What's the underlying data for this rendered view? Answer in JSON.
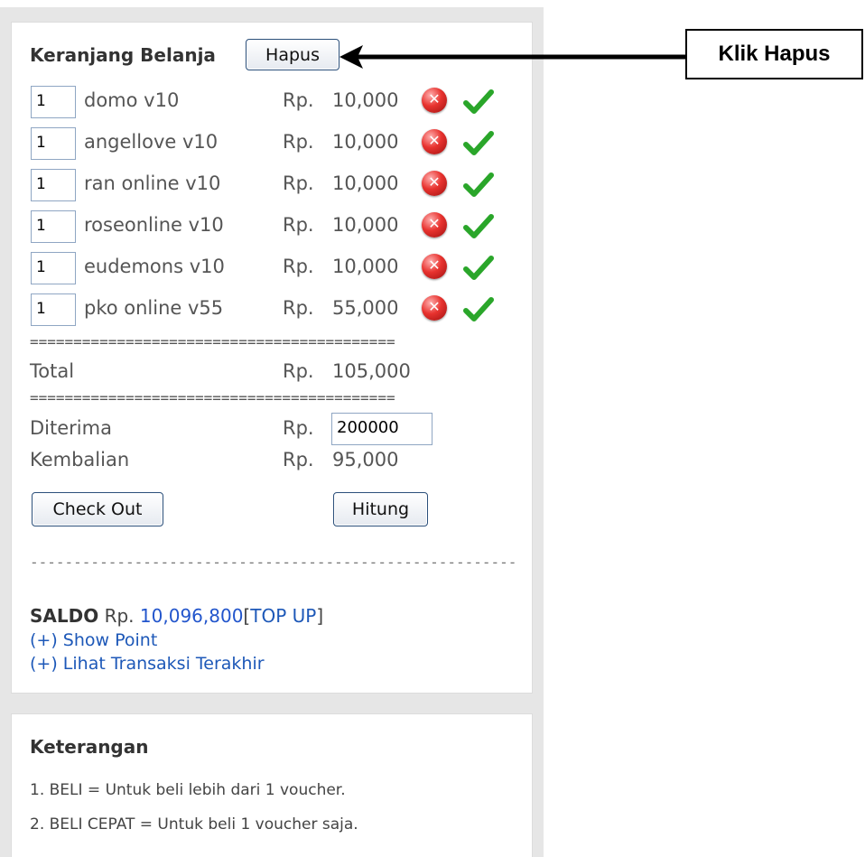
{
  "cart": {
    "title": "Keranjang Belanja",
    "clear_button": "Hapus",
    "currency": "Rp.",
    "items": [
      {
        "qty": "1",
        "name": "domo v10",
        "price": "10,000"
      },
      {
        "qty": "1",
        "name": "angellove v10",
        "price": "10,000"
      },
      {
        "qty": "1",
        "name": "ran online v10",
        "price": "10,000"
      },
      {
        "qty": "1",
        "name": "roseonline v10",
        "price": "10,000"
      },
      {
        "qty": "1",
        "name": "eudemons v10",
        "price": "10,000"
      },
      {
        "qty": "1",
        "name": "pko online v55",
        "price": "55,000"
      }
    ],
    "separator": "==========================================",
    "total_label": "Total",
    "total_value": "105,000",
    "received_label": "Diterima",
    "received_value": "200000",
    "change_label": "Kembalian",
    "change_value": "95,000",
    "checkout_button": "Check Out",
    "calc_button": "Hitung",
    "dashed_line": "----------------------------------------------------------------"
  },
  "balance": {
    "label": "SALDO",
    "currency": "Rp.",
    "amount": "10,096,800",
    "bracket_open": "[",
    "topup": "TOP UP",
    "bracket_close": "]",
    "show_point": "(+) Show Point",
    "recent_transactions": "(+) Lihat Transaksi Terakhir"
  },
  "info": {
    "title": "Keterangan",
    "notes": [
      "1. BELI = Untuk beli lebih dari 1 voucher.",
      "2. BELI CEPAT = Untuk beli 1 voucher saja."
    ]
  },
  "annotation": {
    "callout": "Klik Hapus"
  },
  "icons": {
    "delete": "delete-x-icon",
    "confirm": "checkmark-icon"
  },
  "colors": {
    "link": "#1d58b8",
    "amount": "#2255cc",
    "delete_red": "#e8332f",
    "check_green": "#2aa62a"
  }
}
